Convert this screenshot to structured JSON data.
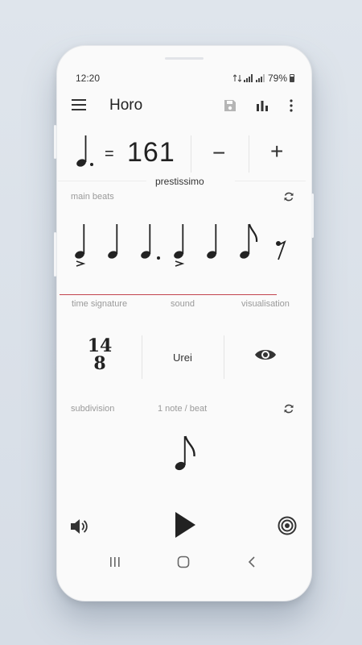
{
  "status_bar": {
    "time": "12:20",
    "battery_percent": "79%"
  },
  "toolbar": {
    "title": "Horo"
  },
  "tempo": {
    "value": "161",
    "equals": "=",
    "minus": "−",
    "plus": "+",
    "marking": "prestissimo"
  },
  "main_beats": {
    "label": "main beats"
  },
  "tabs": {
    "time_signature": "time signature",
    "sound": "sound",
    "visualisation": "visualisation"
  },
  "time_signature": {
    "top": "14",
    "bottom": "8"
  },
  "sound": {
    "value": "Urei"
  },
  "subdivision": {
    "label": "subdivision",
    "value": "1 note / beat"
  },
  "colors": {
    "accent_line": "#c2434d",
    "text": "#222222",
    "label": "#9a9a9a"
  }
}
